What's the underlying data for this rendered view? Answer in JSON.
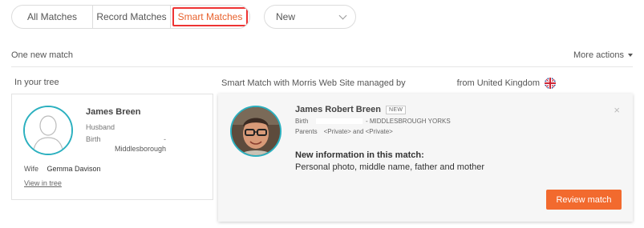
{
  "tabs": {
    "all": "All Matches",
    "record": "Record Matches",
    "smart": "Smart Matches"
  },
  "filter": {
    "selected": "New"
  },
  "summary": {
    "count_text": "One new match",
    "more_actions": "More actions"
  },
  "columns": {
    "left": "In your tree",
    "right_prefix": "Smart Match with Morris Web Site managed by",
    "right_suffix": "from United Kingdom"
  },
  "tree_person": {
    "name": "James Breen",
    "relation": "Husband",
    "birth_label": "Birth",
    "birth_dash": "-",
    "birth_place": "Middlesborough",
    "wife_label": "Wife",
    "wife_name": "Gemma Davison",
    "view_link": "View in tree"
  },
  "match_person": {
    "name": "James Robert Breen",
    "badge": "NEW",
    "birth_label": "Birth",
    "birth_place": "- MIDDLESBROUGH YORKS",
    "parents_label": "Parents",
    "parents_value": "<Private> and <Private>",
    "close": "×",
    "new_info_title": "New information in this match:",
    "new_info_text": "Personal photo, middle name, father and mother",
    "review_button": "Review match"
  },
  "colors": {
    "accent": "#f26a2e",
    "avatar_ring": "#2bb0bf",
    "highlight_box": "#ee3333"
  },
  "icons": {
    "filter_chevron": "chevron-down-icon",
    "more_caret": "caret-down-icon",
    "flag": "uk-flag-icon",
    "close": "close-icon"
  }
}
